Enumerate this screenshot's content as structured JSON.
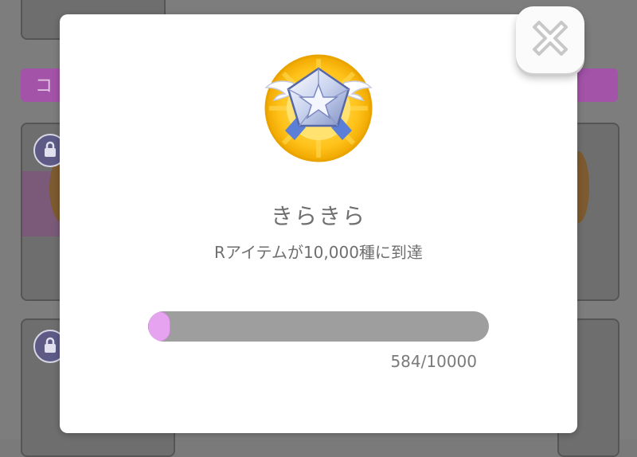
{
  "background": {
    "banner_char": "コ"
  },
  "achievement": {
    "title": "きらきら",
    "description": "Rアイテムが10,000種に到達",
    "progress_text": "584/10000",
    "progress_fraction": 0.0584,
    "badge_icon": "diamond-star-medal-icon"
  },
  "colors": {
    "progress_fill": "#e6a3ef",
    "progress_track": "#9e9e9e",
    "text": "#6f6f6f"
  }
}
